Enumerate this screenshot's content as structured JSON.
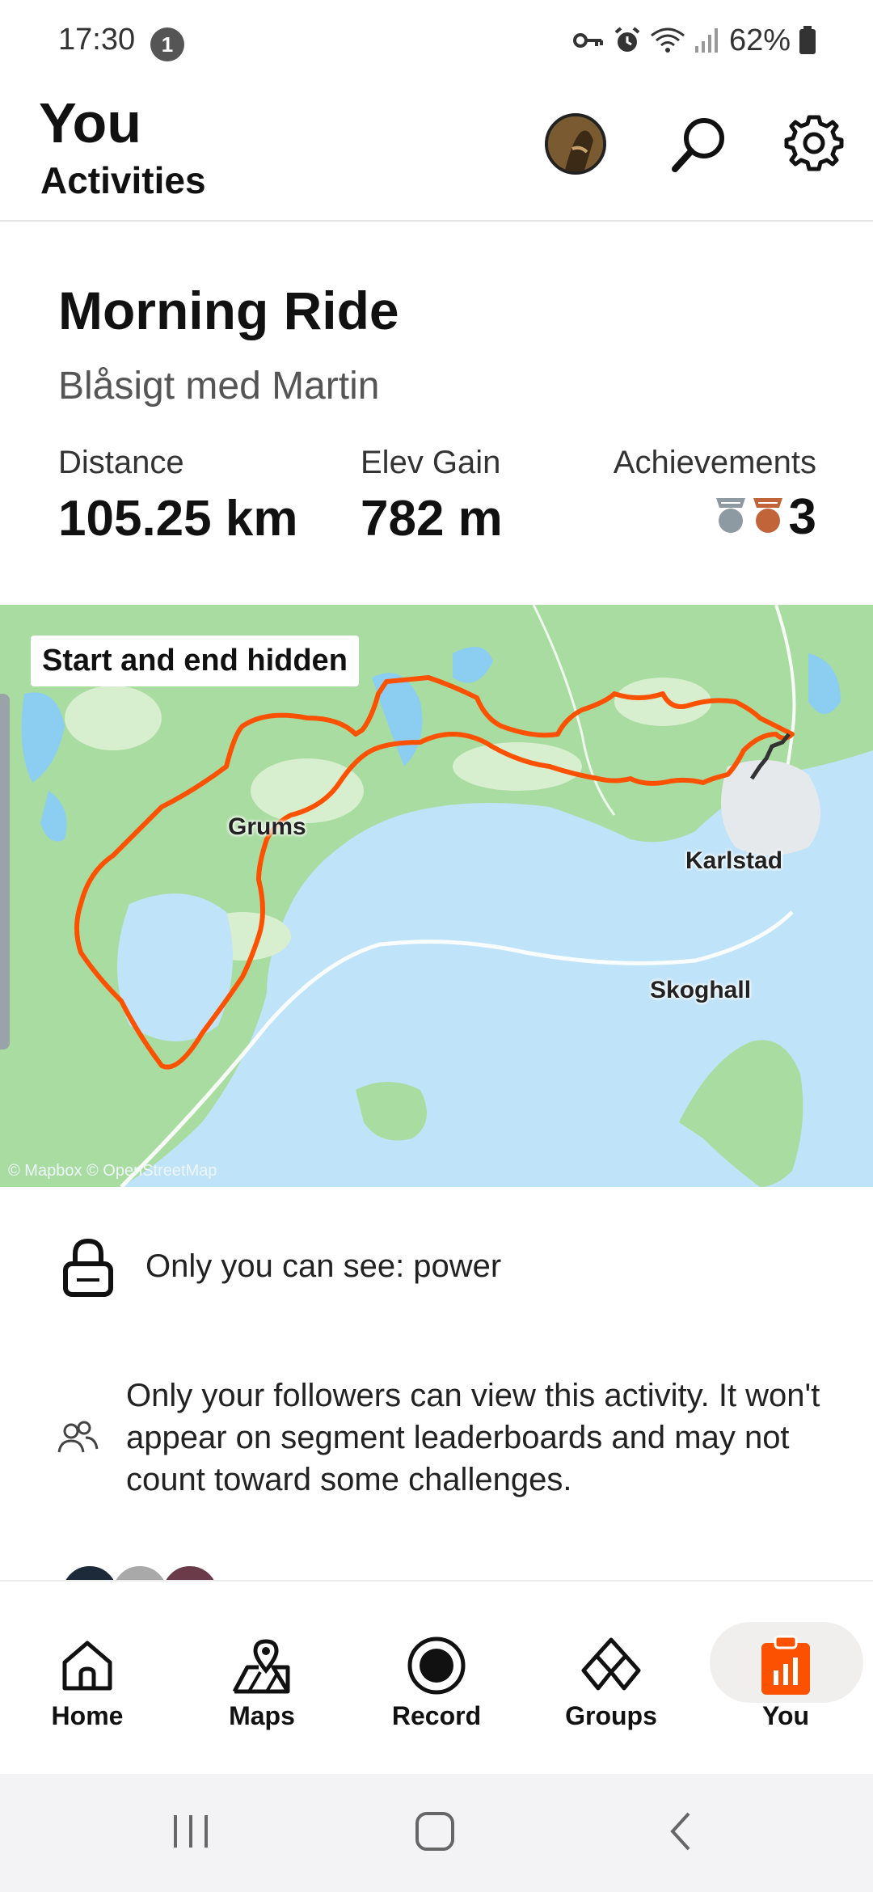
{
  "status_bar": {
    "time": "17:30",
    "notification_count": "1",
    "battery": "62%"
  },
  "header": {
    "title": "You",
    "subtitle": "Activities"
  },
  "activity": {
    "title": "Morning Ride",
    "description": "Blåsigt med Martin",
    "stats": {
      "distance_label": "Distance",
      "distance_value": "105.25 km",
      "elev_label": "Elev Gain",
      "elev_value": "782 m",
      "achievements_label": "Achievements",
      "achievements_count": "3"
    }
  },
  "map": {
    "overlay_label": "Start and end hidden",
    "places": [
      "Grums",
      "Karlstad",
      "Skoghall"
    ],
    "attribution": "© Mapbox © OpenStreetMap",
    "route_color": "#fc5200"
  },
  "privacy": {
    "power_text": "Only you can see: power",
    "followers_text": "Only your followers can view this activity. It won't appear on segment leaderboards and may not count toward some challenges."
  },
  "bottom_nav": {
    "items": [
      {
        "label": "Home",
        "icon": "home-icon"
      },
      {
        "label": "Maps",
        "icon": "maps-icon"
      },
      {
        "label": "Record",
        "icon": "record-icon"
      },
      {
        "label": "Groups",
        "icon": "groups-icon"
      },
      {
        "label": "You",
        "icon": "you-icon"
      }
    ],
    "active": "You",
    "accent_color": "#fc5200"
  }
}
